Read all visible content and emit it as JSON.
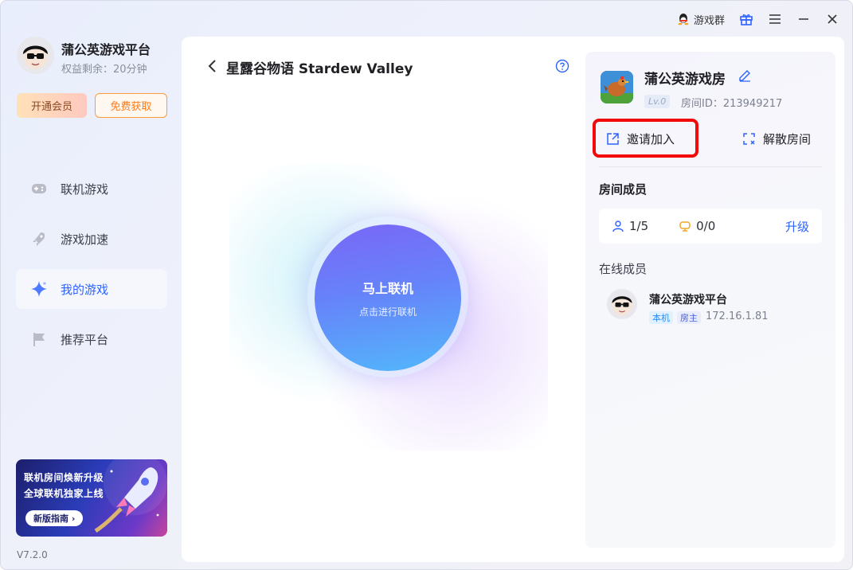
{
  "titlebar": {
    "group_label": "游戏群",
    "icons": [
      "qq-icon",
      "gift-icon",
      "menu-icon",
      "minimize-icon",
      "close-icon"
    ]
  },
  "user": {
    "name": "蒲公英游戏平台",
    "rights": "权益剩余：20分钟",
    "vip_button": "开通会员",
    "free_button": "免费获取"
  },
  "nav": {
    "items": [
      {
        "label": "联机游戏",
        "icon": "gamepad-icon",
        "active": false
      },
      {
        "label": "游戏加速",
        "icon": "rocket-icon",
        "active": false
      },
      {
        "label": "我的游戏",
        "icon": "sparkle-icon",
        "active": true
      },
      {
        "label": "推荐平台",
        "icon": "flag-icon",
        "active": false
      }
    ]
  },
  "banner": {
    "line1": "联机房间焕新升级",
    "line2": "全球联机独家上线",
    "button": "新版指南 ›"
  },
  "version": "V7.2.0",
  "main": {
    "title": "星露谷物语 Stardew Valley",
    "connect_title": "马上联机",
    "connect_sub": "点击进行联机"
  },
  "room": {
    "name": "蒲公英游戏房",
    "level": "Lv.0",
    "room_id": "房间ID：213949217",
    "invite_label": "邀请加入",
    "dissolve_label": "解散房间",
    "members_title": "房间成员",
    "member_count": "1/5",
    "device_count": "0/0",
    "upgrade_label": "升级",
    "online_title": "在线成员",
    "member": {
      "name": "蒲公英游戏平台",
      "tag_local": "本机",
      "tag_host": "房主",
      "ip": "172.16.1.81"
    }
  },
  "colors": {
    "accent": "#2e62ff",
    "highlight": "#f20a0a",
    "orb_top": "#7a66f6",
    "orb_bottom": "#52b8fb"
  }
}
